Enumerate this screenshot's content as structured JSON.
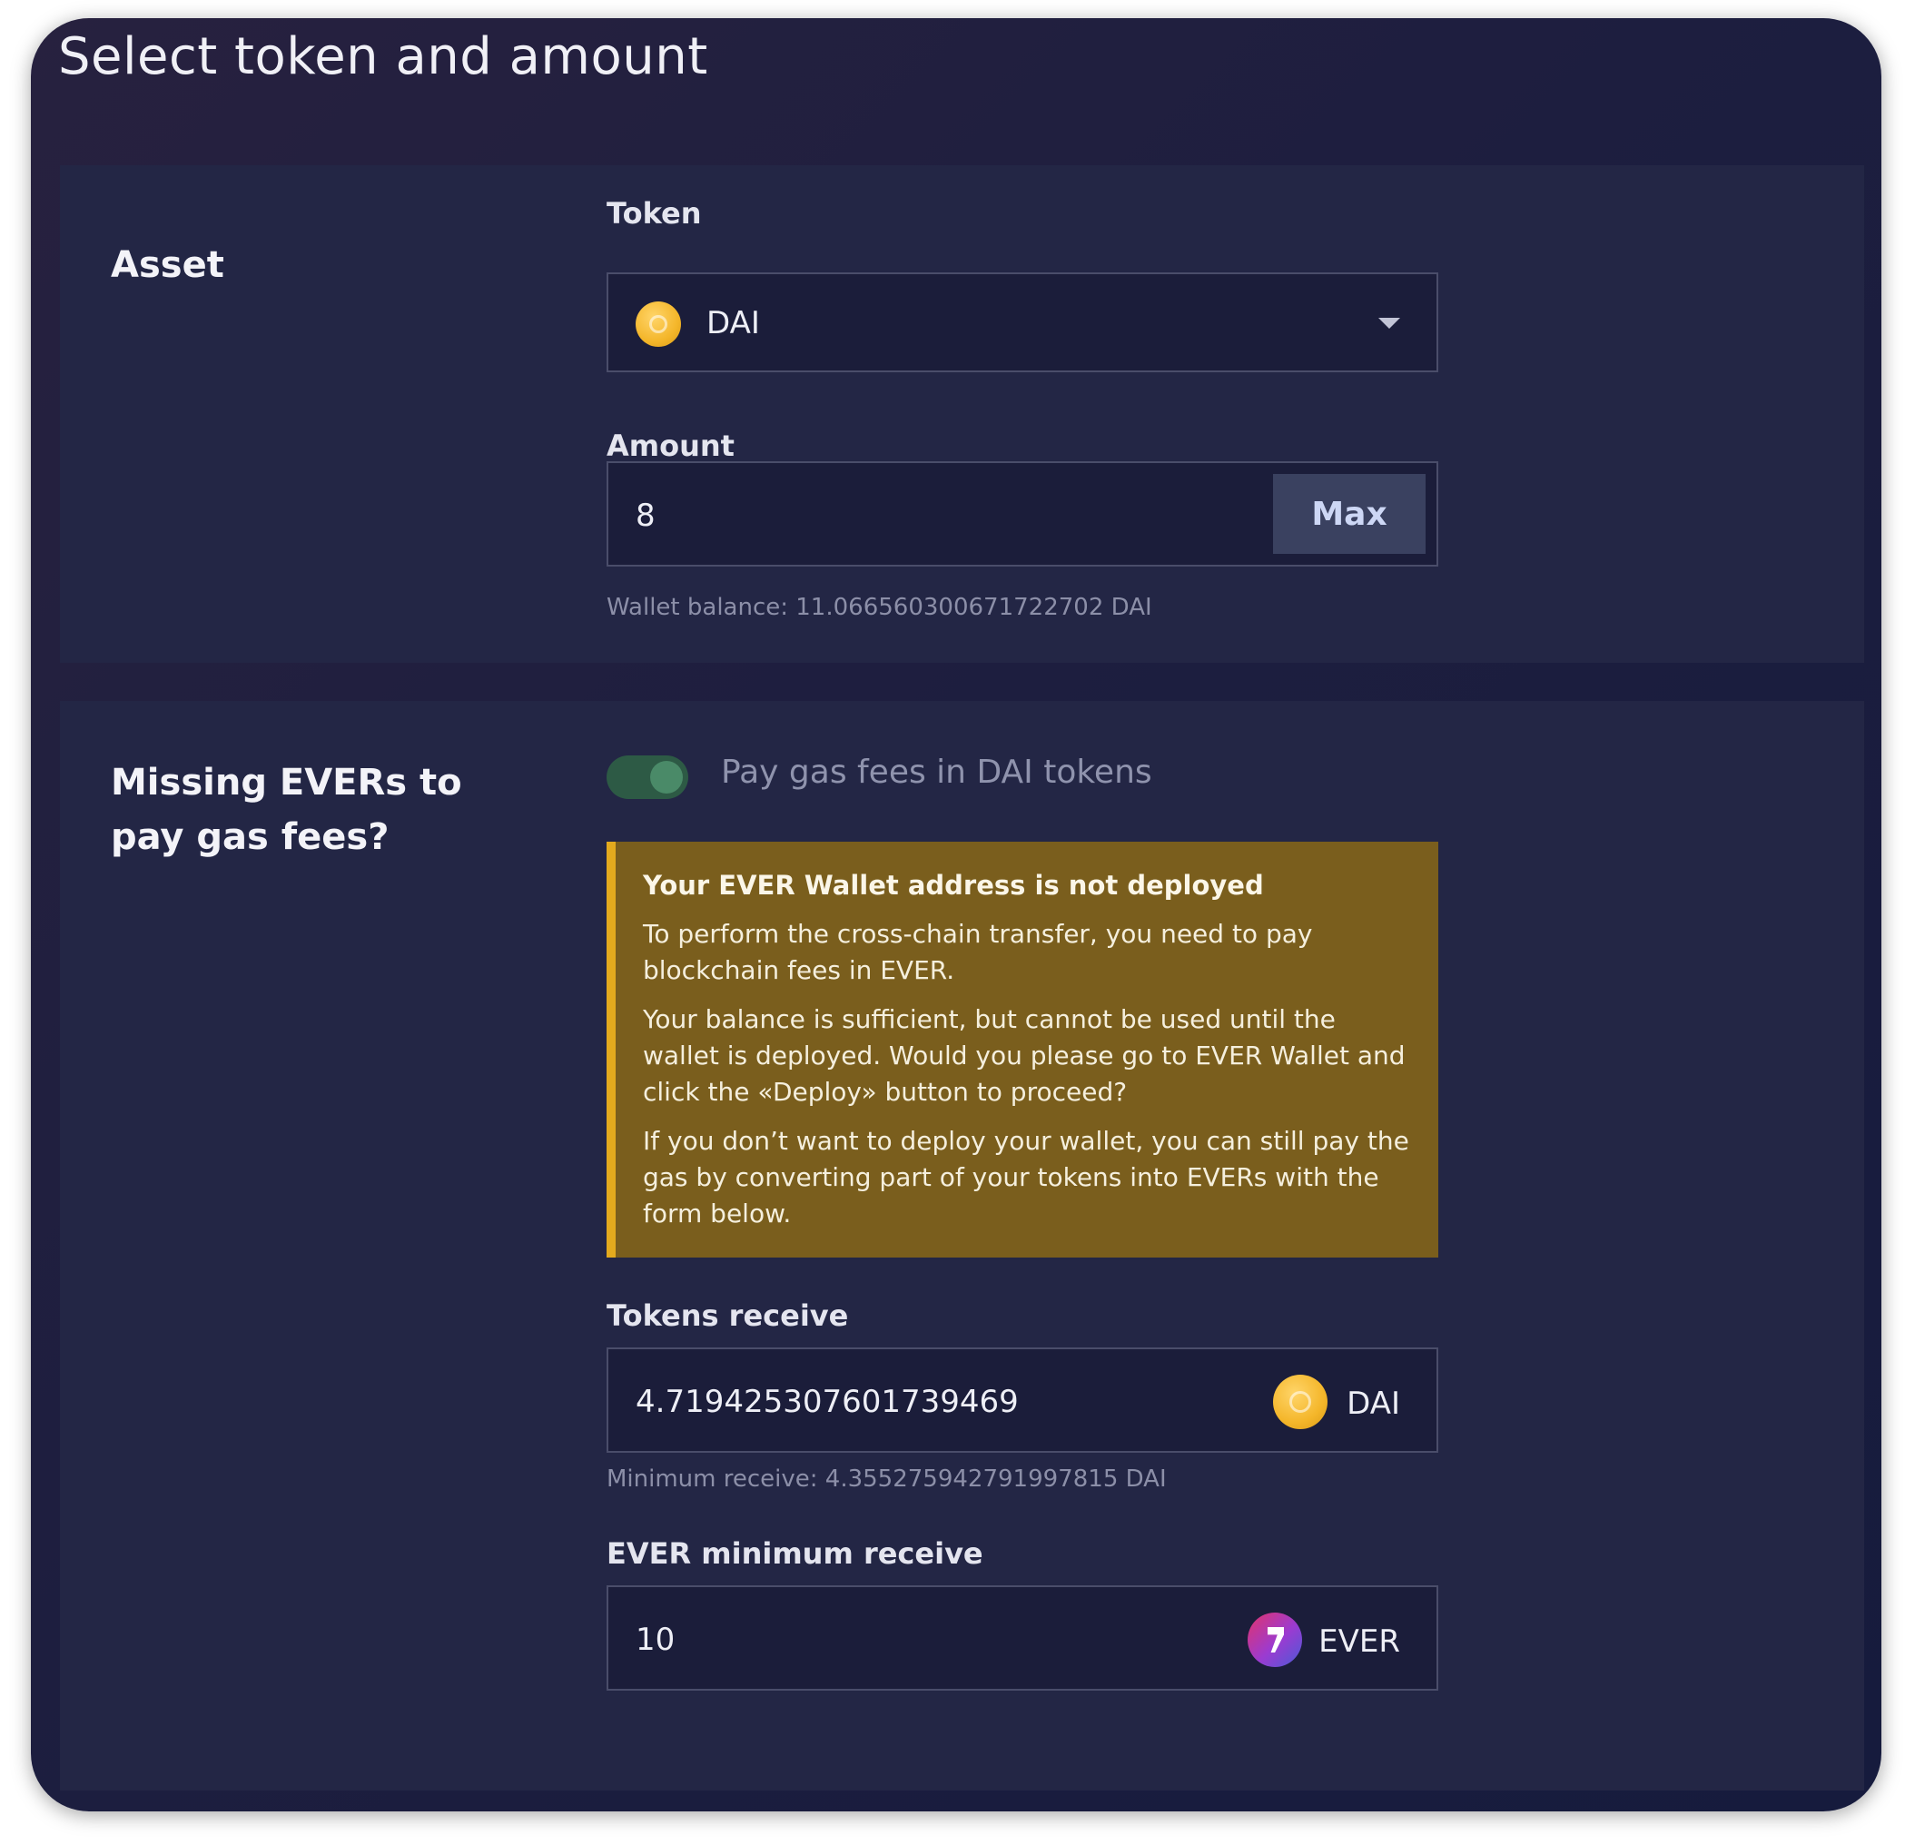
{
  "page": {
    "title": "Select token and amount"
  },
  "asset": {
    "section_label": "Asset",
    "token_label": "Token",
    "token_value": "DAI",
    "token_icon": "dai-coin-icon",
    "amount_label": "Amount",
    "amount_value": "8",
    "max_label": "Max",
    "wallet_balance": "Wallet balance: 11.066560300671722702 DAI"
  },
  "gas": {
    "section_label": "Missing EVERs to pay gas fees?",
    "toggle_label": "Pay gas fees in DAI tokens",
    "toggle_on": true,
    "warning": {
      "title": "Your EVER Wallet address is not deployed",
      "paragraph1": "To perform the cross-chain transfer, you need to pay blockchain fees in EVER.",
      "paragraph2": "Your balance is sufficient, but cannot be used until the wallet is deployed. Would you please go to EVER Wallet and click the «Deploy» button to proceed?",
      "paragraph3": "If you don’t want to deploy your wallet, you can still pay the gas by converting part of your tokens into EVERs with the form below."
    },
    "tokens_receive_label": "Tokens receive",
    "tokens_receive_value": "4.719425307601739469",
    "tokens_receive_symbol": "DAI",
    "minimum_receive": "Minimum receive: 4.355275942791997815 DAI",
    "ever_min_label": "EVER minimum receive",
    "ever_min_value": "10",
    "ever_symbol": "EVER"
  },
  "colors": {
    "background": "#1d1e3f",
    "panel": "#232645",
    "warning_bg": "#7a5e1d",
    "warning_accent": "#e3aa1e",
    "toggle_on": "#2d5a45",
    "dai_coin": "#f4b62a"
  }
}
